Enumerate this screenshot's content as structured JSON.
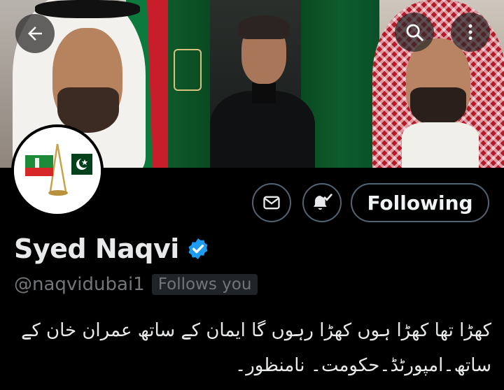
{
  "header": {
    "back_icon": "arrow-left-icon",
    "search_icon": "search-icon",
    "more_icon": "more-vertical-icon"
  },
  "actions": {
    "message_icon": "mail-icon",
    "notify_icon": "bell-check-icon",
    "follow_label": "Following"
  },
  "profile": {
    "display_name": "Syed Naqvi",
    "verified_icon": "verified-badge-icon",
    "handle": "@naqvidubai1",
    "follows_you": "Follows you",
    "bio": "کھڑا تھا کھڑا ہوں کھڑا رہوں گا ایمان کے ساتھ عمران خان کے ساتھ۔امپورٹڈ۔حکومت۔ نامنظور۔"
  },
  "colors": {
    "background": "#000000",
    "text": "#e7e9ea",
    "muted": "#71767b",
    "border": "#536471",
    "verified": "#1d9bf0",
    "pti_red": "#d62828",
    "pti_green": "#1e8b3a",
    "pakistan_green": "#01411c"
  }
}
